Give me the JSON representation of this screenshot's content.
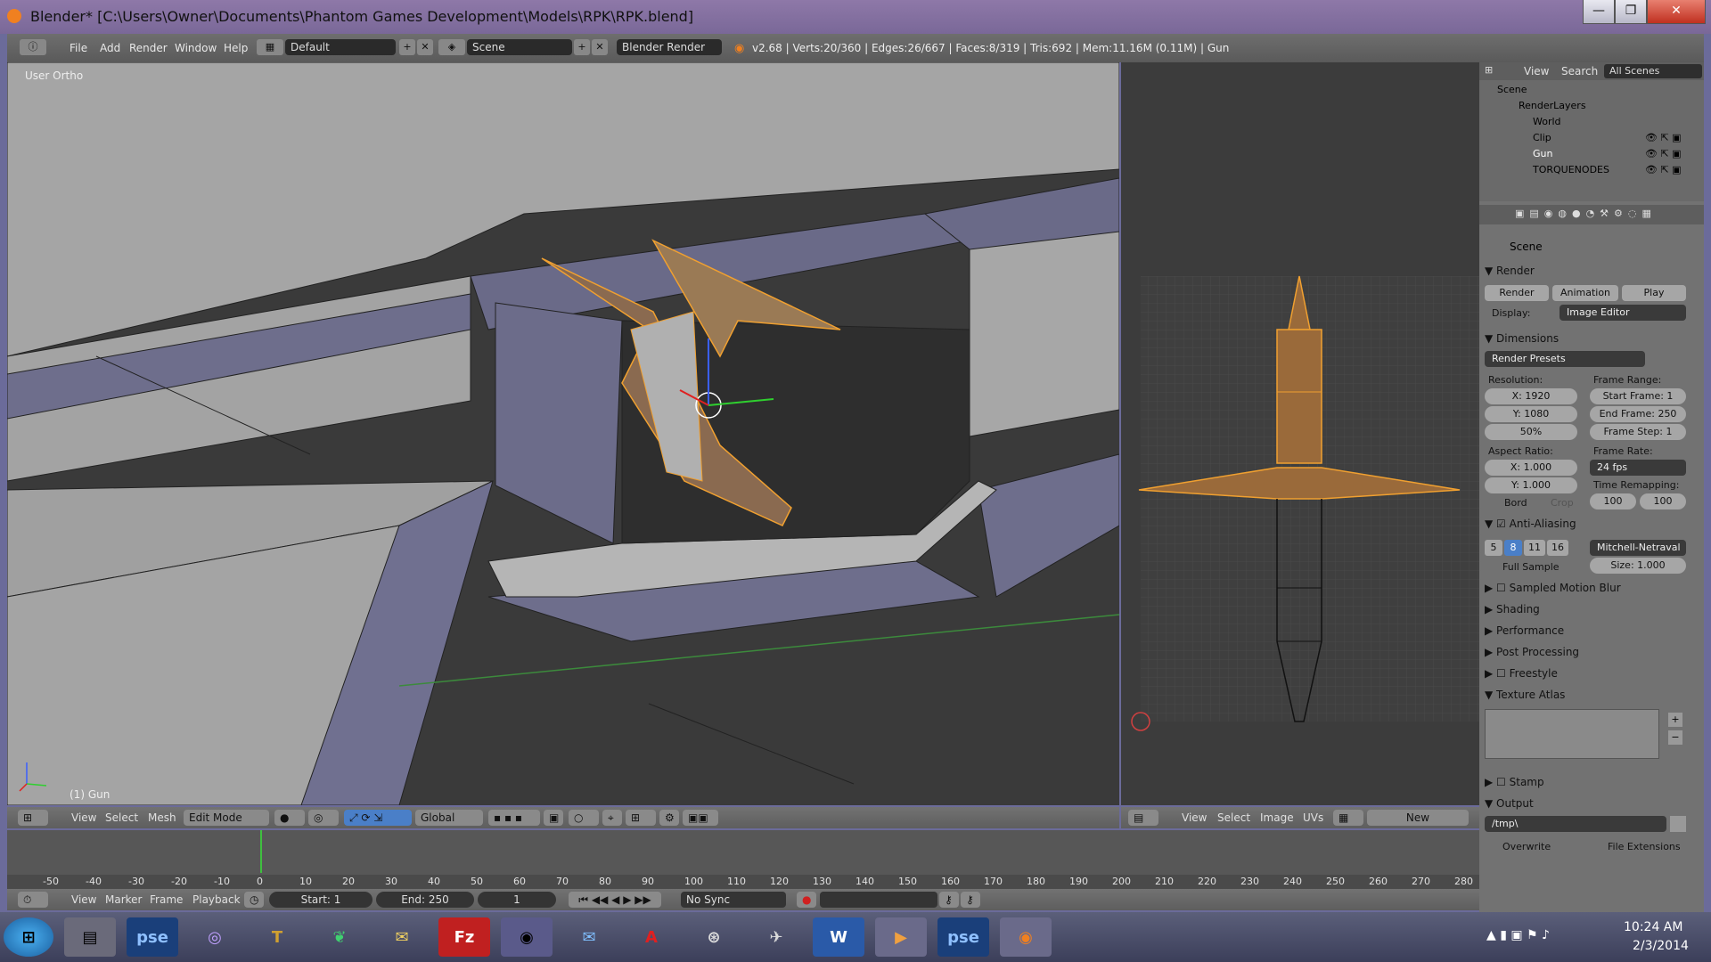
{
  "window": {
    "title": "Blender* [C:\\Users\\Owner\\Documents\\Phantom Games Development\\Models\\RPK\\RPK.blend]",
    "minimize": "—",
    "maximize": "❐",
    "close": "✕"
  },
  "topheader": {
    "menus": [
      "File",
      "Add",
      "Render",
      "Window",
      "Help"
    ],
    "layout": "Default",
    "scene": "Scene",
    "engine": "Blender Render",
    "stats": "v2.68 | Verts:20/360 | Edges:26/667 | Faces:8/319 | Tris:692 | Mem:11.16M (0.11M) | Gun"
  },
  "viewport": {
    "view_label": "User Ortho",
    "object_label": "(1) Gun"
  },
  "viewport_header": {
    "menus": [
      "View",
      "Select",
      "Mesh"
    ],
    "mode": "Edit Mode",
    "orientation": "Global"
  },
  "uv_header": {
    "menus": [
      "View",
      "Select",
      "Image",
      "UVs"
    ],
    "new_label": "New"
  },
  "timeline": {
    "ticks": [
      "-50",
      "-40",
      "-30",
      "-20",
      "-10",
      "0",
      "10",
      "20",
      "30",
      "40",
      "50",
      "60",
      "70",
      "80",
      "90",
      "100",
      "110",
      "120",
      "130",
      "140",
      "150",
      "160",
      "170",
      "180",
      "190",
      "200",
      "210",
      "220",
      "230",
      "240",
      "250",
      "260",
      "270",
      "280"
    ],
    "menus": [
      "View",
      "Marker",
      "Frame",
      "Playback"
    ],
    "start": "Start: 1",
    "end": "End: 250",
    "current": "1",
    "sync": "No Sync"
  },
  "outliner": {
    "menus": [
      "View",
      "Search"
    ],
    "filter": "All Scenes",
    "items": [
      "Scene",
      "RenderLayers",
      "World",
      "Clip",
      "Gun",
      "TORQUENODES"
    ]
  },
  "properties": {
    "context": "Scene",
    "render": {
      "header": "Render",
      "render_btn": "Render",
      "animation_btn": "Animation",
      "play_btn": "Play",
      "display_label": "Display:",
      "display_value": "Image Editor"
    },
    "dimensions": {
      "header": "Dimensions",
      "presets": "Render Presets",
      "resolution_label": "Resolution:",
      "res_x": "X: 1920",
      "res_y": "Y: 1080",
      "res_pct": "50%",
      "frame_range_label": "Frame Range:",
      "start_frame": "Start Frame: 1",
      "end_frame": "End Frame: 250",
      "frame_step": "Frame Step: 1",
      "aspect_label": "Aspect Ratio:",
      "aspect_x": "X: 1.000",
      "aspect_y": "Y: 1.000",
      "frame_rate_label": "Frame Rate:",
      "frame_rate": "24 fps",
      "time_remap_label": "Time Remapping:",
      "remap_old": "100",
      "remap_new": "100",
      "bord": "Bord",
      "crop": "Crop"
    },
    "anti_aliasing": {
      "header": "Anti-Aliasing",
      "samples": [
        "5",
        "8",
        "11",
        "16"
      ],
      "filter": "Mitchell-Netraval",
      "full_sample": "Full Sample",
      "size": "Size: 1.000"
    },
    "panels": [
      "Sampled Motion Blur",
      "Shading",
      "Performance",
      "Post Processing",
      "Freestyle",
      "Texture Atlas",
      "Stamp",
      "Output"
    ],
    "output_path": "/tmp\\",
    "overwrite": "Overwrite",
    "file_extensions": "File Extensions"
  },
  "taskbar": {
    "icons": [
      "start-orb",
      "explorer",
      "pse",
      "unity",
      "torque",
      "plant",
      "certificate",
      "filezilla",
      "chrome",
      "thunderbird",
      "adobe",
      "steam",
      "blackbird",
      "word",
      "media",
      "pse2",
      "blender"
    ],
    "time": "10:24 AM",
    "date": "2/3/2014"
  },
  "colors": {
    "selection": "#f0a030",
    "face_gray": "#a3a3a3",
    "face_blue": "#6e6e8c",
    "accent_blue": "#4a7fc8"
  }
}
